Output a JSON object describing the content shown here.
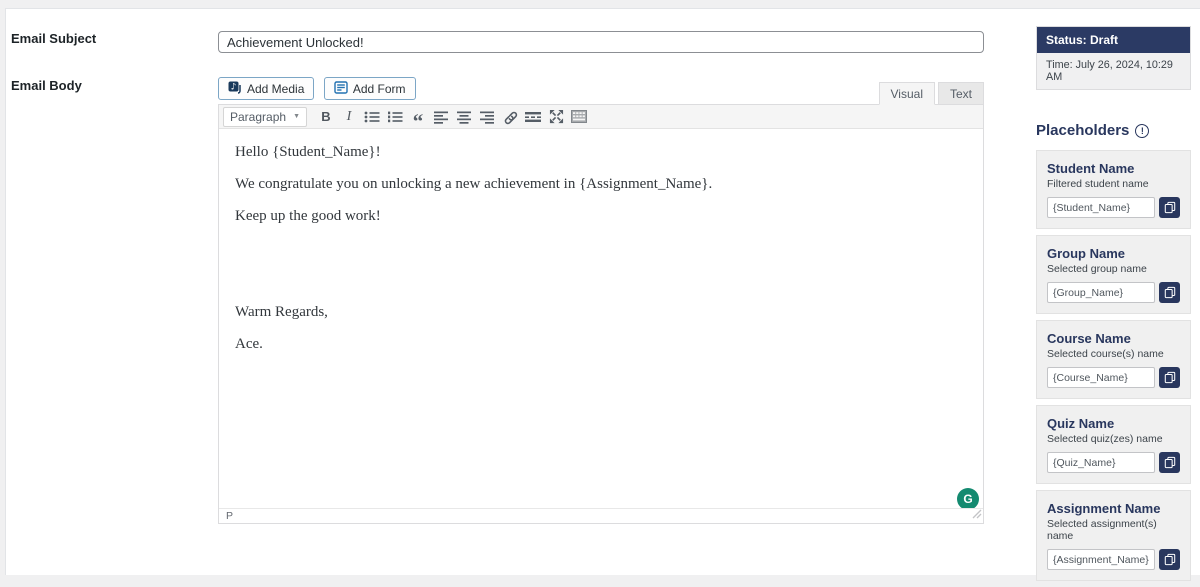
{
  "labels": {
    "email_subject": "Email Subject",
    "email_body": "Email Body"
  },
  "subject": {
    "value": "Achievement Unlocked!"
  },
  "editor": {
    "add_media_label": "Add Media",
    "add_form_label": "Add Form",
    "tabs": {
      "visual": "Visual",
      "text": "Text"
    },
    "toolbar": {
      "paragraph_label": "Paragraph",
      "icons": [
        "bold",
        "italic",
        "bulleted-list",
        "numbered-list",
        "blockquote",
        "align-left",
        "align-center",
        "align-right",
        "insert-link",
        "read-more",
        "fullscreen",
        "toolbar-toggle"
      ],
      "bold_glyph": "B",
      "italic_glyph": "I",
      "blockquote_glyph": "“"
    },
    "content": [
      "Hello {Student_Name}!",
      "We congratulate you on unlocking a new achievement in {Assignment_Name}.",
      "Keep up the good work!",
      "",
      "",
      "Warm Regards,",
      "Ace."
    ],
    "path_indicator": "P",
    "grammarly_glyph": "G"
  },
  "status_box": {
    "status": "Status: Draft",
    "time": "Time: July 26, 2024, 10:29 AM"
  },
  "placeholders": {
    "heading": "Placeholders",
    "info_glyph": "!",
    "cards": [
      {
        "title": "Student Name",
        "description": "Filtered student name",
        "value": "{Student_Name}"
      },
      {
        "title": "Group Name",
        "description": "Selected group name",
        "value": "{Group_Name}"
      },
      {
        "title": "Course Name",
        "description": "Selected course(s) name",
        "value": "{Course_Name}"
      },
      {
        "title": "Quiz Name",
        "description": "Selected quiz(zes) name",
        "value": "{Quiz_Name}"
      },
      {
        "title": "Assignment Name",
        "description": "Selected assignment(s) name",
        "value": "{Assignment_Name}"
      }
    ]
  },
  "colors": {
    "navy": "#2b3a64",
    "placeholder_navy": "#29375e",
    "grammarly_green": "#148a70"
  }
}
